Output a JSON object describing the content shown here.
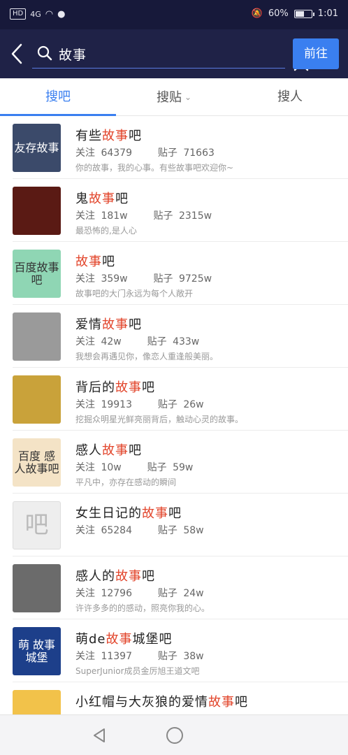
{
  "status": {
    "left_badge": "HD",
    "signal_label": "4G",
    "battery_text": "60%",
    "battery_level": 0.6,
    "time": "1:01"
  },
  "search": {
    "query": "故事",
    "go_label": "前往"
  },
  "tabs": [
    {
      "label": "搜吧",
      "active": true
    },
    {
      "label": "搜贴",
      "active": false
    },
    {
      "label": "搜人",
      "active": false
    }
  ],
  "results": [
    {
      "pre": "有些",
      "hl": "故事",
      "post": "吧",
      "follow_label": "关注",
      "follow": "64379",
      "posts_label": "贴子",
      "posts": "71663",
      "desc": "你的故事，我的心事。有些故事吧欢迎你~",
      "thumb_text": "友存故事",
      "thumb_color": "#3b4a6a"
    },
    {
      "pre": "鬼",
      "hl": "故事",
      "post": "吧",
      "follow_label": "关注",
      "follow": "181w",
      "posts_label": "贴子",
      "posts": "2315w",
      "desc": "最恐怖的,是人心",
      "thumb_text": "",
      "thumb_color": "#5a1a14"
    },
    {
      "pre": "",
      "hl": "故事",
      "post": "吧",
      "follow_label": "关注",
      "follow": "359w",
      "posts_label": "贴子",
      "posts": "9725w",
      "desc": "故事吧的大门永远为每个人敞开",
      "thumb_text": "百度故事吧",
      "thumb_color": "#8fd6b4"
    },
    {
      "pre": "爱情",
      "hl": "故事",
      "post": "吧",
      "follow_label": "关注",
      "follow": "42w",
      "posts_label": "贴子",
      "posts": "433w",
      "desc": "我想会再遇见你，像恋人重逢般美丽。",
      "thumb_text": "",
      "thumb_color": "#9a9a9a"
    },
    {
      "pre": "背后的",
      "hl": "故事",
      "post": "吧",
      "follow_label": "关注",
      "follow": "19913",
      "posts_label": "贴子",
      "posts": "26w",
      "desc": "挖掘众明星光鲜亮丽背后，触动心灵的故事。",
      "thumb_text": "",
      "thumb_color": "#c9a23a"
    },
    {
      "pre": "感人",
      "hl": "故事",
      "post": "吧",
      "follow_label": "关注",
      "follow": "10w",
      "posts_label": "贴子",
      "posts": "59w",
      "desc": "平凡中，亦存在感动的瞬间",
      "thumb_text": "百度 感人故事吧",
      "thumb_color": "#f4e3c6"
    },
    {
      "pre": "女生日记的",
      "hl": "故事",
      "post": "吧",
      "follow_label": "关注",
      "follow": "65284",
      "posts_label": "贴子",
      "posts": "58w",
      "desc": "",
      "thumb_text": "吧",
      "thumb_color": "#eeeeee"
    },
    {
      "pre": "感人的",
      "hl": "故事",
      "post": "吧",
      "follow_label": "关注",
      "follow": "12796",
      "posts_label": "贴子",
      "posts": "24w",
      "desc": "许许多多的的感动，照亮你我的心。",
      "thumb_text": "",
      "thumb_color": "#6b6b6b"
    },
    {
      "pre": "萌de",
      "hl": "故事",
      "post": "城堡吧",
      "follow_label": "关注",
      "follow": "11397",
      "posts_label": "贴子",
      "posts": "38w",
      "desc": "SuperJunior成员金厉旭王道文吧",
      "thumb_text": "萌 故事城堡",
      "thumb_color": "#1d3f8a"
    },
    {
      "pre": "小红帽与大灰狼的爱情",
      "hl": "故事",
      "post": "吧",
      "follow_label": "",
      "follow": "",
      "posts_label": "",
      "posts": "",
      "desc": "",
      "thumb_text": "",
      "thumb_color": "#f2c24a"
    }
  ],
  "colors": {
    "accent": "#3a7ff0",
    "highlight": "#e2452b",
    "header_bg": "#1f2247"
  }
}
